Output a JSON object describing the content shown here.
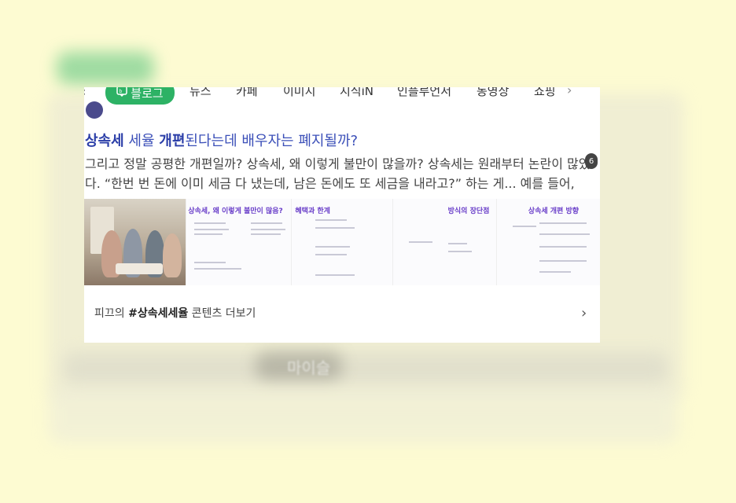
{
  "tabs": {
    "active": "블로그",
    "items": [
      "뉴스",
      "카페",
      "이미지",
      "지식iN",
      "인플루언서",
      "동영상",
      "쇼핑"
    ]
  },
  "post": {
    "title_parts": [
      "상속세",
      " 세율 ",
      "개편",
      "된다는데 배우자는 폐지될까?"
    ],
    "description": "그리고 정말 공평한 개편일까? 상속세, 왜 이렇게 불만이 많을까? 상속세는 원래부터 논란이 많았다. “한번 번 돈에 이미 세금 다 냈는데, 남은 돈에도 또 세금을 내라고?” 하는 게... 예를 들어, 상...",
    "image_count": "6",
    "doc_titles": [
      "상속세, 왜 이렇게 불만이 많음?",
      "혜택과 한계",
      "방식의 장단점",
      "상속세 개편 방향"
    ]
  },
  "more": {
    "prefix": "피끄의 ",
    "tag": "#상속세세율",
    "suffix": " 콘텐츠 더보기"
  },
  "background": {
    "faint_text": "마이슬"
  },
  "colors": {
    "page_bg": "#fdfbd2",
    "accent_green": "#2db265",
    "title_blue": "#3b4fb8"
  }
}
